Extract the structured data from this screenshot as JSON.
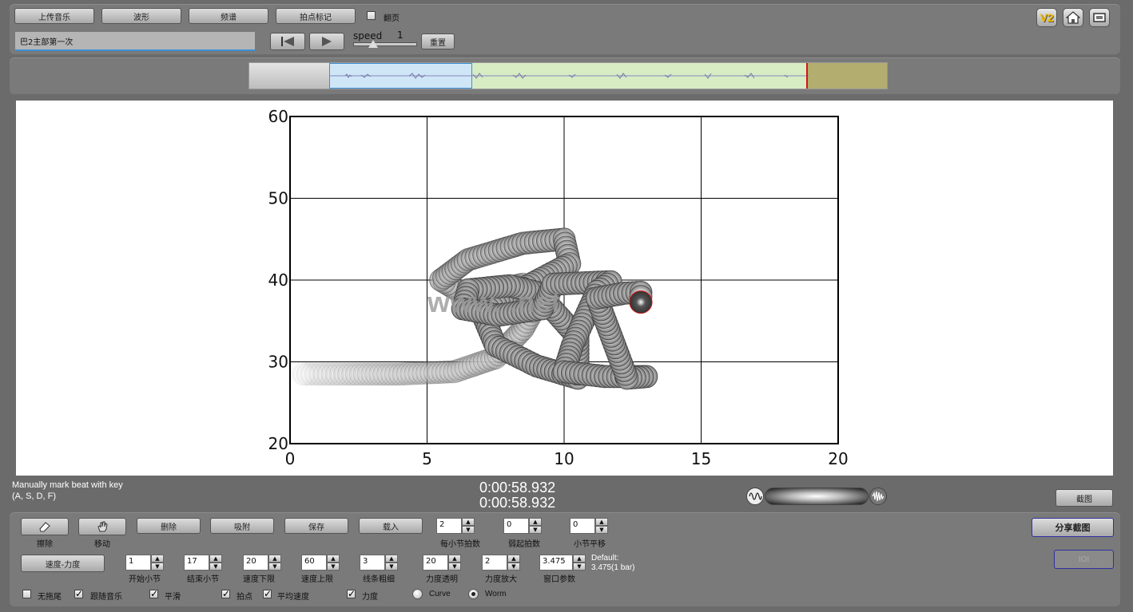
{
  "toolbar": {
    "upload_music": "上传音乐",
    "waveform": "波形",
    "spectrum": "频谱",
    "beat_mark": "拍点标记",
    "flip_page_label": "翻页",
    "track_name": "巴2主部第一次",
    "speed_label": "speed",
    "speed_value": "1",
    "reset": "重置"
  },
  "top_right": {
    "v2_badge": "V2"
  },
  "status": {
    "hint_line1": "Manually mark beat with key",
    "hint_line2": "(A, S, D, F)",
    "time_1": "0:00:58.932",
    "time_2": "0:00:58.932",
    "screenshot": "截图"
  },
  "controls": {
    "erase": "擦除",
    "move": "移动",
    "delete": "删除",
    "snap": "吸附",
    "save": "保存",
    "load": "载入",
    "share_screenshot": "分享截图",
    "ioi": "IOI",
    "tempo_dynamics": "速度-力度",
    "beats_per_bar_value": "2",
    "beats_per_bar_label": "每小节拍数",
    "pickup_beats_value": "0",
    "pickup_beats_label": "弱起拍数",
    "bar_offset_value": "0",
    "bar_offset_label": "小节平移",
    "start_bar_value": "1",
    "start_bar_label": "开始小节",
    "end_bar_value": "17",
    "end_bar_label": "结束小节",
    "tempo_min_value": "20",
    "tempo_min_label": "速度下限",
    "tempo_max_value": "60",
    "tempo_max_label": "速度上限",
    "line_width_value": "3",
    "line_width_label": "线条粗细",
    "dyn_transparency_value": "20",
    "dyn_transparency_label": "力度透明",
    "dyn_zoom_value": "2",
    "dyn_zoom_label": "力度放大",
    "window_param_value": "3.475",
    "window_param_label": "窗口参数",
    "default_line1": "Default:",
    "default_line2": "3.475(1 bar)",
    "no_tail": "无拖尾",
    "follow_music": "跟随音乐",
    "smooth": "平滑",
    "beat_points": "拍点",
    "avg_tempo": "平均速度",
    "dynamics": "力度",
    "curve": "Curve",
    "worm": "Worm"
  },
  "colors": {
    "accent_blue": "#3a8fd6",
    "region_blue": "#cfe6f7",
    "region_green": "#d8ecc4",
    "region_olive": "#b3ad6f",
    "marker_red": "#d31515",
    "v2_yellow": "#f2c200"
  },
  "chart_data": {
    "type": "line",
    "style": "worm",
    "xlim": [
      0,
      20
    ],
    "ylim": [
      20,
      60
    ],
    "x_ticks": [
      "0",
      "5",
      "10",
      "15",
      "20"
    ],
    "y_ticks": [
      "20",
      "30",
      "40",
      "50",
      "60"
    ],
    "grid": true,
    "watermark": "www.        .net",
    "worm_path": [
      [
        0.5,
        28.5
      ],
      [
        2,
        28.5
      ],
      [
        4,
        28.5
      ],
      [
        6,
        28.8
      ],
      [
        7.5,
        30.5
      ],
      [
        8.5,
        34
      ],
      [
        9,
        37
      ],
      [
        8.5,
        39.5
      ],
      [
        6.5,
        38
      ],
      [
        5.5,
        40
      ],
      [
        6.5,
        42.5
      ],
      [
        8.5,
        44.5
      ],
      [
        10,
        45
      ],
      [
        10.2,
        42
      ],
      [
        8.5,
        39
      ],
      [
        7,
        36
      ],
      [
        7.5,
        32
      ],
      [
        9,
        29.5
      ],
      [
        10.5,
        28
      ],
      [
        10.5,
        33
      ],
      [
        9.7,
        36
      ],
      [
        9,
        38.5
      ],
      [
        8,
        39.3
      ],
      [
        6.5,
        38.8
      ],
      [
        6.3,
        36.5
      ],
      [
        7.6,
        35.7
      ],
      [
        9.2,
        36.5
      ],
      [
        9.6,
        39.5
      ],
      [
        11.7,
        39.8
      ],
      [
        11.2,
        38.6
      ],
      [
        10.3,
        32
      ],
      [
        10,
        28.8
      ],
      [
        11.5,
        28.2
      ],
      [
        13,
        28.2
      ],
      [
        12.3,
        28
      ],
      [
        11.2,
        37.8
      ],
      [
        12.2,
        38.4
      ],
      [
        12.8,
        38.5
      ],
      [
        12.8,
        37.5
      ]
    ],
    "current_point": [
      12.8,
      37.3
    ]
  }
}
